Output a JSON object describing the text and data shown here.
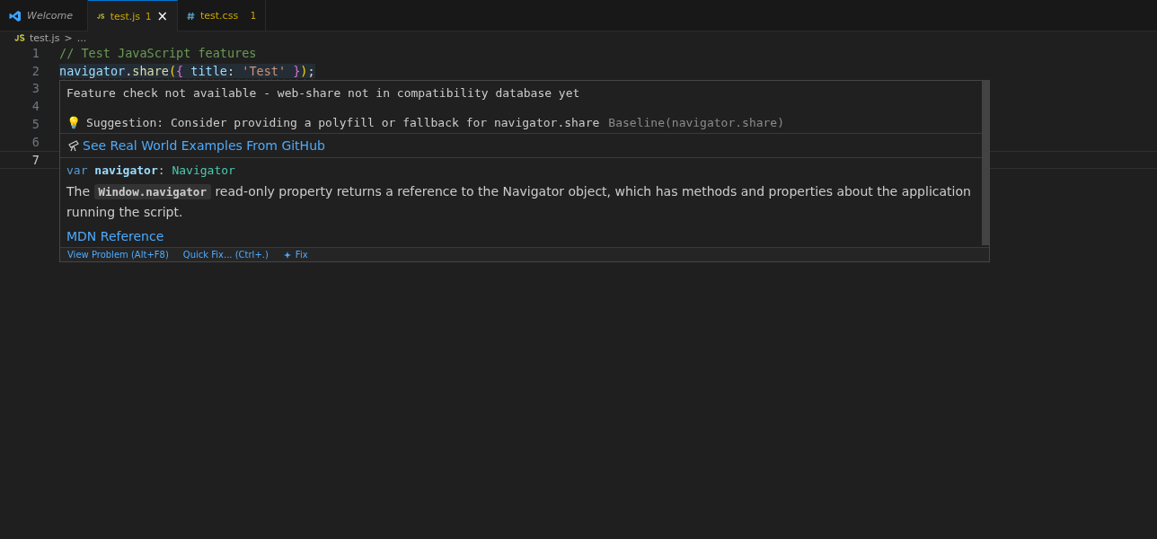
{
  "tabs": [
    {
      "label": "Welcome",
      "kind": "vscode",
      "selected": false,
      "italic": true
    },
    {
      "label": "test.js",
      "kind": "js",
      "selected": true,
      "badge": "1",
      "close": "×"
    },
    {
      "label": "test.css",
      "kind": "css",
      "selected": false,
      "badge": "1"
    }
  ],
  "breadcrumb": {
    "file": "test.js",
    "separator": ">",
    "rest": "..."
  },
  "editor": {
    "lines": [
      {
        "number": "1",
        "current": false,
        "tokens": [
          {
            "text": "// Test JavaScript features",
            "kind": "comment"
          }
        ]
      },
      {
        "number": "2",
        "current": false,
        "warning": true,
        "tokens": [
          {
            "text": "navigator",
            "kind": "variable"
          },
          {
            "text": ".",
            "kind": "plain"
          },
          {
            "text": "share",
            "kind": "function"
          },
          {
            "text": "(",
            "kind": "bracket1"
          },
          {
            "text": "{",
            "kind": "bracket2"
          },
          {
            "text": " title",
            "kind": "variable"
          },
          {
            "text": ": ",
            "kind": "plain"
          },
          {
            "text": "'Test'",
            "kind": "string"
          },
          {
            "text": " }",
            "kind": "bracket2"
          },
          {
            "text": ")",
            "kind": "bracket1"
          },
          {
            "text": ";",
            "kind": "plain"
          }
        ]
      },
      {
        "number": "3",
        "current": false
      },
      {
        "number": "4",
        "current": false
      },
      {
        "number": "5",
        "current": false
      },
      {
        "number": "6",
        "current": false
      },
      {
        "number": "7",
        "current": true
      }
    ]
  },
  "hover": {
    "message": "Feature check not available - web-share not in compatibility database yet",
    "suggestion": {
      "icon": "💡",
      "text": "Suggestion: Consider providing a polyfill or fallback for navigator.share",
      "source": "Baseline(navigator.share)"
    },
    "link": "See Real World Examples From GitHub",
    "signature": [
      {
        "text": "var",
        "kind": "keyword"
      },
      {
        "text": " navigator",
        "kind": "name"
      },
      {
        "text": ": ",
        "kind": "plain"
      },
      {
        "text": "Navigator",
        "kind": "type"
      }
    ],
    "doc": {
      "before": "The",
      "code": "Window.navigator",
      "after": "read-only property returns a reference to the Navigator object, which has methods and properties about the application running the script."
    },
    "reference": "MDN Reference",
    "actions": [
      {
        "label": "View Problem (Alt+F8)",
        "icon": false
      },
      {
        "label": "Quick Fix... (Ctrl+.)",
        "icon": false
      },
      {
        "label": "Fix",
        "icon": true
      }
    ]
  }
}
